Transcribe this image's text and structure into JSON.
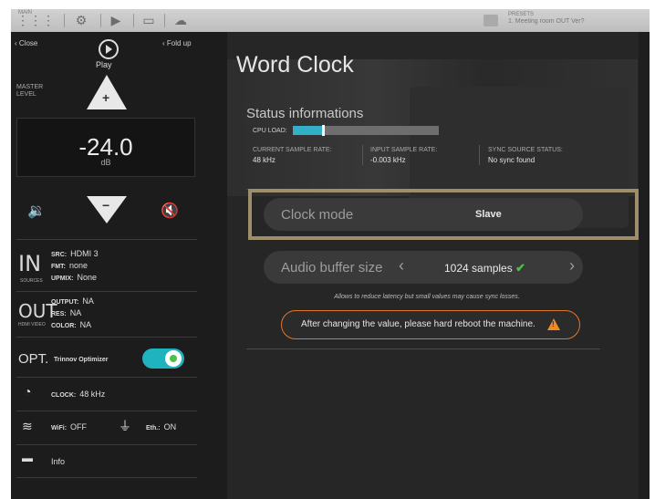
{
  "topbar": {
    "grid_label": "MAIN",
    "preset_label": "PRESETS",
    "preset_name": "1. Meeting room OUT Ver?"
  },
  "sidebar": {
    "close_label": "Close",
    "play_label": "Play",
    "fold_label": "Fold up",
    "master_label_line1": "MASTER",
    "master_label_line2": "LEVEL",
    "level_value": "-24.0",
    "level_unit": "dB",
    "in": {
      "tag": "IN",
      "sub": "SOURCES",
      "src_key": "SRC:",
      "src_val": "HDMI 3",
      "fmt_key": "FMT:",
      "fmt_val": "none",
      "upmix_key": "UPMIX:",
      "upmix_val": "None"
    },
    "out": {
      "tag": "OUT",
      "sub": "HDMI VIDEO",
      "output_key": "OUTPUT:",
      "output_val": "NA",
      "res_key": "RES:",
      "res_val": "NA",
      "color_key": "COLOR:",
      "color_val": "NA"
    },
    "opt": {
      "tag": "OPT.",
      "label": "Trinnov Optimizer",
      "enabled": true
    },
    "clock": {
      "key": "CLOCK:",
      "val": "48 kHz"
    },
    "wifi": {
      "key": "WiFi:",
      "val": "OFF"
    },
    "eth": {
      "key": "Eth.:",
      "val": "ON"
    },
    "info_label": "Info"
  },
  "main": {
    "title": "Word Clock",
    "status_title": "Status informations",
    "cpu_label": "CPU LOAD:",
    "cpu_load_fraction": 0.2,
    "stats": [
      {
        "label": "CURRENT SAMPLE RATE:",
        "value": "48 kHz"
      },
      {
        "label": "INPUT SAMPLE RATE:",
        "value": "-0.003 kHz"
      },
      {
        "label": "SYNC SOURCE STATUS:",
        "value": "No sync found"
      }
    ],
    "clock_mode": {
      "label": "Clock mode",
      "value": "Slave"
    },
    "buffer": {
      "label": "Audio buffer size",
      "value": "1024 samples"
    },
    "hint": "Allows to reduce latency but small values may cause sync losses.",
    "warning": "After changing the value, please hard reboot the machine."
  },
  "colors": {
    "accent": "#1fb3c0",
    "warning": "#e0762a",
    "highlight_frame": "#9c8f6a",
    "ok": "#4cc04c"
  }
}
